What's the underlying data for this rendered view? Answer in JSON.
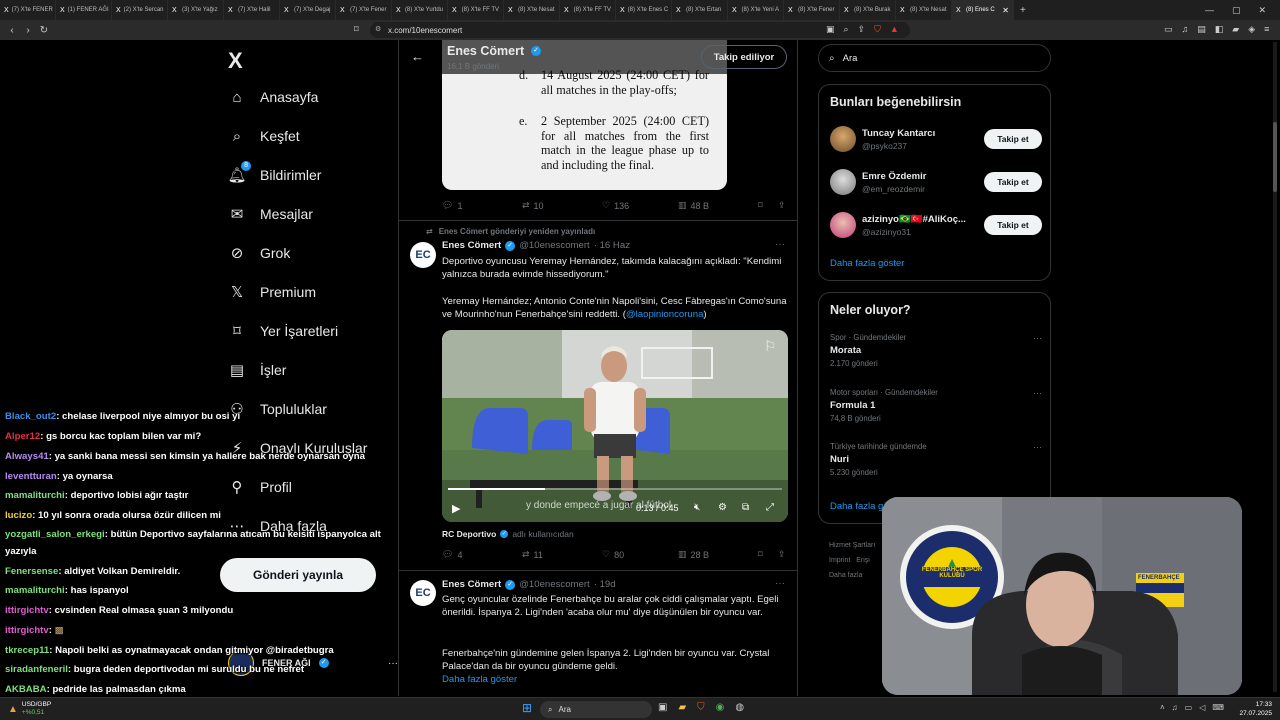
{
  "tabs": [
    {
      "label": "(7) X'te FENER"
    },
    {
      "label": "(1) FENER AĞI"
    },
    {
      "label": "(2) X'te Sercan"
    },
    {
      "label": "(3) X'te Yağız"
    },
    {
      "label": "(7) X'te Halil"
    },
    {
      "label": "(7) X'te Degaj"
    },
    {
      "label": "(7) X'te Fener"
    },
    {
      "label": "(8) X'te Yurtdu"
    },
    {
      "label": "(8) X'te FF TV"
    },
    {
      "label": "(8) X'te Nesat"
    },
    {
      "label": "(8) X'te FF TV"
    },
    {
      "label": "(8) X'te Enes C"
    },
    {
      "label": "(8) X'te Ertan"
    },
    {
      "label": "(8) X'te Yeni A"
    },
    {
      "label": "(8) X'te Fener"
    },
    {
      "label": "(8) X'te Burak"
    },
    {
      "label": "(8) X'te Nesat"
    },
    {
      "label": "(8) Enes C"
    }
  ],
  "url": "x.com/10enescomert",
  "left_nav": {
    "logo": "X",
    "items": [
      {
        "label": "Anasayfa"
      },
      {
        "label": "Keşfet"
      },
      {
        "label": "Bildirimler",
        "badge": "8"
      },
      {
        "label": "Mesajlar"
      },
      {
        "label": "Grok"
      },
      {
        "label": "Premium"
      },
      {
        "label": "Yer İşaretleri"
      },
      {
        "label": "İşler"
      },
      {
        "label": "Topluluklar"
      },
      {
        "label": "Onaylı Kuruluşlar"
      },
      {
        "label": "Profil"
      },
      {
        "label": "Daha fazla"
      }
    ],
    "post_button": "Gönderi yayınla",
    "account_name": "FENER AĞI"
  },
  "header": {
    "name": "Enes Cömert",
    "subtitle": "16,1 B gönderi",
    "follow_state": "Takip ediliyor"
  },
  "doc_image": {
    "items": [
      {
        "marker": "d.",
        "text": "14 August 2025 (24:00 CET) for all matches in the play-offs;"
      },
      {
        "marker": "e.",
        "text": "2 September 2025 (24:00 CET) for all matches from the first match in the league phase up to and including the final."
      }
    ]
  },
  "tweet0_actions": {
    "replies": "1",
    "reposts": "10",
    "likes": "136",
    "views": "48 B"
  },
  "tweet1": {
    "repost_label": "Enes Cömert gönderiyi yeniden yayınladı",
    "name": "Enes Cömert",
    "handle": "@10enescomert",
    "date": "· 16 Haz",
    "text1": "Deportivo oyuncusu Yeremay Hernández, takımda kalacağını açıkladı: \"Kendimi yalnızca burada evimde hissediyorum.\"",
    "text2": "Yeremay Hernández; Antonio Conte'nin Napoli'sini, Cesc Fàbregas'ın Como'suna ve Mourinho'nun Fenerbahçe'sini reddetti. (",
    "mention": "@laopinioncoruna",
    "text2_end": ")",
    "video_caption": "y donde empecé a jugar al fútbol",
    "video_time": "0:13 / 0:45",
    "video_progress": 0.29,
    "source_name": "RC Deportivo",
    "source_suffix": "adlı kullanıcıdan",
    "replies": "4",
    "reposts": "11",
    "likes": "80",
    "views": "28 B"
  },
  "tweet2": {
    "name": "Enes Cömert",
    "handle": "@10enescomert",
    "date": "· 19d",
    "text1": "Genç oyuncular özelinde Fenerbahçe bu aralar çok ciddi çalışmalar yaptı. Egeli önerildi. İspanya 2. Ligi'nden 'acaba olur mu' diye düşünülen bir oyuncu var.",
    "text2": "Fenerbahçe'nin gündemine gelen İspanya 2. Ligi'nden bir oyuncu var. Crystal Palace'dan da bir oyuncu gündeme geldi.",
    "more": "Daha fazla göster"
  },
  "search": {
    "placeholder": "Ara"
  },
  "suggestions": {
    "title": "Bunları beğenebilirsin",
    "users": [
      {
        "name": "Tuncay Kantarcı",
        "handle": "@psyko237",
        "button": "Takip et"
      },
      {
        "name": "Emre Özdemir",
        "handle": "@em_reozdemir",
        "button": "Takip et"
      },
      {
        "name": "azizinyo🇧🇷🇹🇷#AliKoç...",
        "handle": "@azizinyo31",
        "button": "Takip et"
      }
    ],
    "more": "Daha fazla göster"
  },
  "trends": {
    "title": "Neler oluyor?",
    "items": [
      {
        "context": "Spor · Gündemdekiler",
        "topic": "Morata",
        "count": "2.170 gönderi"
      },
      {
        "context": "Motor sporları · Gündemdekiler",
        "topic": "Formula 1",
        "count": "74,8 B gönderi"
      },
      {
        "context": "Türkiye tarihinde gündemde",
        "topic": "Nuri",
        "count": "5.230 gönderi"
      }
    ],
    "more": "Daha fazla göster"
  },
  "footer": {
    "line1": "Hizmet Şartları",
    "line2a": "Imprint",
    "line2b": "Erişi",
    "line3": "Daha fazla"
  },
  "chat": [
    {
      "user": "Black_out2",
      "color": "#3b8eea",
      "msg": ": chelase liverpool niye almıyor bu osi yi"
    },
    {
      "user": "Alper12",
      "color": "#e0304a",
      "msg": ": gs borcu kac toplam bilen var mi?"
    },
    {
      "user": "Always41",
      "color": "#b58cf0",
      "msg": ": ya sanki bana messi sen kimsin ya hallere bak nerde oynarsan oyna"
    },
    {
      "user": "leventturan",
      "color": "#b58cf0",
      "msg": ": ya oynarsa"
    },
    {
      "user": "mamaliturchi",
      "color": "#7ee07e",
      "msg": ": deportivo lobisi ağır taştır"
    },
    {
      "user": "lucizo",
      "color": "#f0d23a",
      "msg": ": 10 yıl sonra orada olursa özür dilicen mi"
    },
    {
      "user": "yozgatli_salon_erkegi",
      "color": "#7ee07e",
      "msg": ": bütün Deportivo sayfalarına atıcam bu keisiti ispanyolca alt"
    },
    {
      "user": "",
      "color": "#fff",
      "msg": "yazıyla"
    },
    {
      "user": "Fenersense",
      "color": "#7ee07e",
      "msg": ": aldiyet Volkan Demireldir."
    },
    {
      "user": "mamaliturchi",
      "color": "#7ee07e",
      "msg": ": has ispanyol"
    },
    {
      "user": "ittirgichtv",
      "color": "#e05bd0",
      "msg": ": cvsinden Real olmasa şuan 3 milyondu"
    },
    {
      "user": "ittirgichtv",
      "color": "#e05bd0",
      "msg": ":"
    },
    {
      "user": "tkrecep11",
      "color": "#7ee07e",
      "msg": ": Napoli belki as oynatmayacak ondan gitmiyor @biradetbugra"
    },
    {
      "user": "siradanfeneril",
      "color": "#7ee07e",
      "msg": ": bugra deden deportivodan mi suruldu bu ne nefret"
    },
    {
      "user": "AKBABA",
      "color": "#7ee07e",
      "msg": ": pedride las palmasdan çıkma"
    }
  ],
  "taskbar": {
    "ticker_name": "USD/GBP",
    "ticker_value": "+%0,51",
    "search": "Ara",
    "time": "17:33",
    "date": "27.07.2025"
  },
  "webcam": {
    "crest_text": "FENERBAHÇE SPOR KULÜBÜ",
    "crest_year": "1907",
    "sign": "FENERBAHÇE"
  }
}
